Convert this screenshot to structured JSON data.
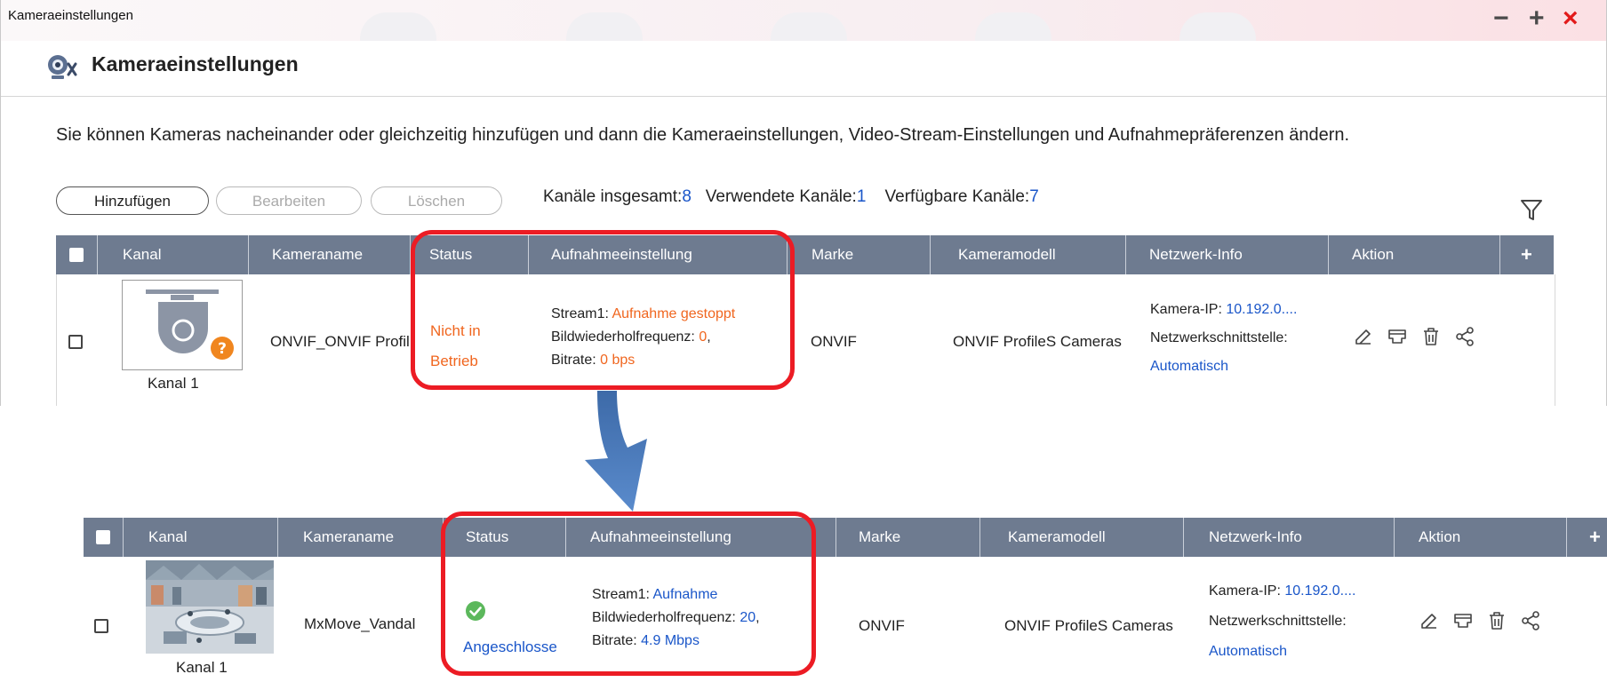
{
  "window": {
    "title": "Kameraeinstellungen",
    "header_title": "Kameraeinstellungen",
    "controls": [
      "−",
      "+",
      "×"
    ]
  },
  "intro_text": "Sie können Kameras nacheinander oder gleichzeitig hinzufügen und dann die Kameraeinstellungen, Video-Stream-Einstellungen und Aufnahmepräferenzen ändern.",
  "toolbar": {
    "add_label": "Hinzufügen",
    "edit_label": "Bearbeiten",
    "delete_label": "Löschen"
  },
  "stats": {
    "total_label": "Kanäle insgesamt:",
    "total_value": "8",
    "used_label": "Verwendete Kanäle:",
    "used_value": "1",
    "available_label": "Verfügbare Kanäle:",
    "available_value": "7"
  },
  "columns": [
    "Kanal",
    "Kameraname",
    "Status",
    "Aufnahmeeinstellung",
    "Marke",
    "Kameramodell",
    "Netzwerk-Info",
    "Aktion",
    "+"
  ],
  "before_row": {
    "channel": "Kanal 1",
    "camera_name": "ONVIF_ONVIF Profil",
    "status_line1": "Nicht in",
    "status_line2": "Betrieb",
    "stream_label": "Stream1: ",
    "stream_value": "Aufnahme gestoppt",
    "fps_label": "Bildwiederholfrequenz: ",
    "fps_value": "0",
    "fps_suffix": ",",
    "bitrate_label": "Bitrate: ",
    "bitrate_value": "0 bps",
    "brand": "ONVIF",
    "model": "ONVIF ProfileS Cameras",
    "ip_label": "Kamera-IP: ",
    "ip_value": "10.192.0....",
    "iface_label": "Netzwerkschnittstelle:",
    "iface_value": "Automatisch"
  },
  "after_row": {
    "channel": "Kanal 1",
    "camera_name": "MxMove_Vandal",
    "status": "Angeschlosse",
    "stream_label": "Stream1: ",
    "stream_value": "Aufnahme",
    "fps_label": "Bildwiederholfrequenz: ",
    "fps_value": "20",
    "fps_suffix": ",",
    "bitrate_label": "Bitrate: ",
    "bitrate_value": "4.9 Mbps",
    "brand": "ONVIF",
    "model": "ONVIF ProfileS Cameras",
    "ip_label": "Kamera-IP: ",
    "ip_value": "10.192.0....",
    "iface_label": "Netzwerkschnittstelle:",
    "iface_value": "Automatisch"
  },
  "action_icons": [
    "edit-icon",
    "stream-icon",
    "trash-icon",
    "share-icon"
  ],
  "colors": {
    "header_bg": "#6e7b90",
    "highlight": "#ec1c24",
    "arrow": "#4a7bbd",
    "link_blue": "#1a56c9",
    "warn_orange": "#f0661f",
    "ok_green": "#5cb85c",
    "close_red": "#e21a1a"
  }
}
